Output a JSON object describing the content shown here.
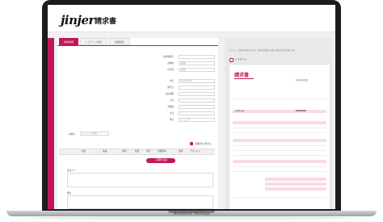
{
  "app": {
    "logo": "jinjer",
    "product": "請求書"
  },
  "tabs": [
    "基本情報",
    "レスアップ表示",
    "詳細設定"
  ],
  "form": {
    "fields": [
      {
        "label": "請求書番号",
        "value": ""
      },
      {
        "label": "請求先",
        "value": "未選択"
      },
      {
        "label": "担当者",
        "value": "未選択"
      },
      {
        "label": "件名",
        "value": "2024年4月分"
      },
      {
        "label": "発行日",
        "value": ""
      },
      {
        "label": "支払期限",
        "value": ""
      },
      {
        "label": "小計",
        "value": ""
      },
      {
        "label": "消費税",
        "value": ""
      },
      {
        "label": "合計",
        "value": ""
      },
      {
        "label": "備考",
        "value": "ここに入力"
      }
    ],
    "search_label": "請求先",
    "search_placeholder": "キーワードで検索",
    "checkbox_label": "消費税を計算する",
    "table_headers": [
      "品目",
      "品番",
      "単価",
      "数量",
      "単位",
      "消費税率",
      "金額",
      "アクション"
    ],
    "add_button": "+ 明細を追加",
    "section_note": "社内メモ",
    "section_remark": "備考"
  },
  "preview": {
    "note": "プレビューは自動で更新されます。実際の請求書とは表示が異なる場合があります。",
    "option": "ロゴを表示する",
    "title": "請求書",
    "company": "jinjer株式会社",
    "total_label": "ご請求金額",
    "total": "¥100,000"
  },
  "device": {
    "label": "Notebook Mockup"
  },
  "colors": {
    "accent": "#c2185b",
    "frame": "#1c1c1c"
  }
}
